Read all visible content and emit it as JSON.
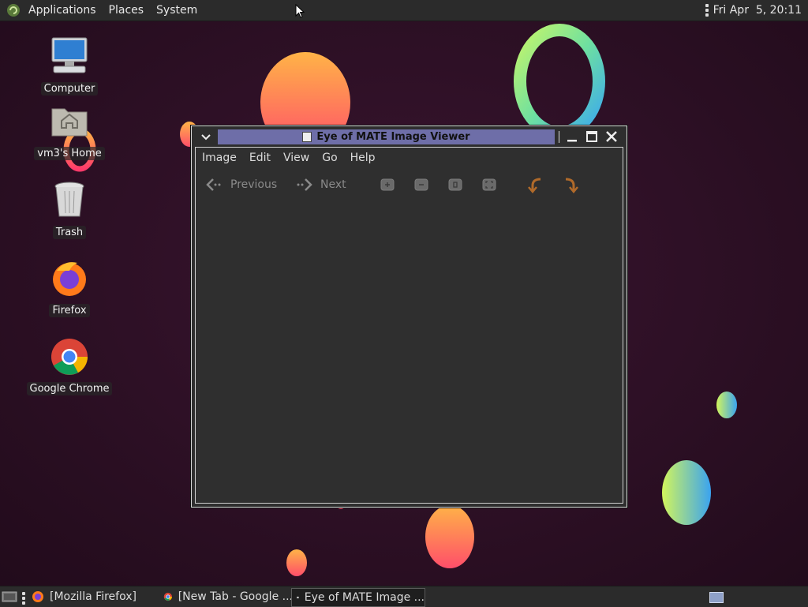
{
  "top_panel": {
    "menus": [
      "Applications",
      "Places",
      "System"
    ],
    "clock": "Fri Apr  5, 20:11"
  },
  "desktop_icons": [
    {
      "label": "Computer",
      "icon": "computer-icon"
    },
    {
      "label": "vm3's Home",
      "icon": "home-folder-icon"
    },
    {
      "label": "Trash",
      "icon": "trash-icon"
    },
    {
      "label": "Firefox",
      "icon": "firefox-icon"
    },
    {
      "label": "Google Chrome",
      "icon": "chrome-icon"
    }
  ],
  "window": {
    "title": "Eye of MATE Image Viewer",
    "menus": [
      "Image",
      "Edit",
      "View",
      "Go",
      "Help"
    ],
    "toolbar": {
      "previous_label": "Previous",
      "next_label": "Next"
    }
  },
  "taskbar": {
    "tasks": [
      {
        "label": "[Mozilla Firefox]",
        "icon": "firefox-icon"
      },
      {
        "label": "[New Tab - Google ...",
        "icon": "chrome-icon"
      },
      {
        "label": "Eye of MATE Image ...",
        "icon": "image-viewer-icon",
        "active": true
      }
    ]
  },
  "colors": {
    "panel_bg": "#2b2b2b",
    "desktop_bg": "#2a0f22",
    "title_active": "#6e6ea8",
    "window_bg": "#2f2f2f"
  }
}
